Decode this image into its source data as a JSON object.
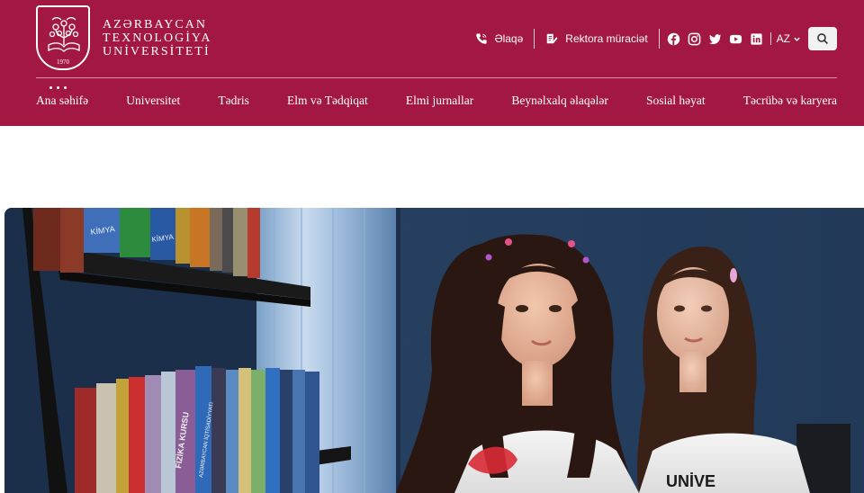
{
  "logo": {
    "line1": "AZƏRBAYCAN",
    "line2": "TEXNOLOGİYA",
    "line3": "UNİVERSİTETİ",
    "year": "1970"
  },
  "topbar": {
    "contact_label": "Əlaqə",
    "rector_label": "Rektora müraciət",
    "lang": "AZ",
    "icons": [
      "phone-icon",
      "note-icon",
      "facebook-icon",
      "instagram-icon",
      "twitter-icon",
      "youtube-icon",
      "linkedin-icon",
      "search-icon"
    ]
  },
  "nav": {
    "items": [
      {
        "label": "Ana səhifə"
      },
      {
        "label": "Universitet"
      },
      {
        "label": "Tədris"
      },
      {
        "label": "Elm və Tədqiqat"
      },
      {
        "label": "Elmi jurnallar"
      },
      {
        "label": "Beynəlxalq əlaqələr"
      },
      {
        "label": "Sosial həyat"
      },
      {
        "label": "Təcrübə və karyera"
      }
    ]
  },
  "hero": {
    "book_spines": [
      "KİMYA",
      "FİZİKA KURSU",
      "KİMYA",
      "AZƏRBAYCAN İQTİSADİYYATI"
    ],
    "shirt_text": "UNİVE"
  },
  "colors": {
    "brand": "#a31842",
    "white": "#ffffff"
  }
}
